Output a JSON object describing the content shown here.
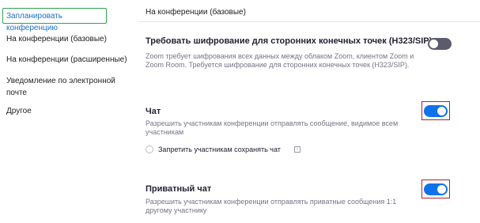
{
  "sidebar": {
    "items": [
      {
        "label": "Запланировать конференцию"
      },
      {
        "label": "На конференции (базовые)"
      },
      {
        "label": "На конференции (расширенные)"
      },
      {
        "label": "Уведомление по электронной почте"
      },
      {
        "label": "Другое"
      }
    ]
  },
  "main": {
    "section_title": "На конференции (базовые)",
    "settings": [
      {
        "title": "Требовать шифрование для сторонних конечных точек (H323/SIP)",
        "description": "Zoom требует шифрования всех данных между облаком Zoom, клиентом Zoom и Zoom Room. Требуется шифрование для сторонних конечных точек (H323/SIP).",
        "enabled": false
      },
      {
        "title": "Чат",
        "description": "Разрешить участникам конференции отправлять сообщение, видимое всем участникам",
        "enabled": true,
        "option": {
          "label": "Запретить участникам сохранять чат",
          "checked": false,
          "icon": "info-icon"
        }
      },
      {
        "title": "Приватный чат",
        "description": "Разрешить участникам конференции отправлять приватные сообщения 1:1 другому участнику",
        "enabled": true
      }
    ]
  },
  "colors": {
    "toggle_on": "#0e72ed",
    "toggle_off": "#5b5b6b",
    "active_border": "#2ea44f",
    "highlight_border": "#b3202a"
  }
}
